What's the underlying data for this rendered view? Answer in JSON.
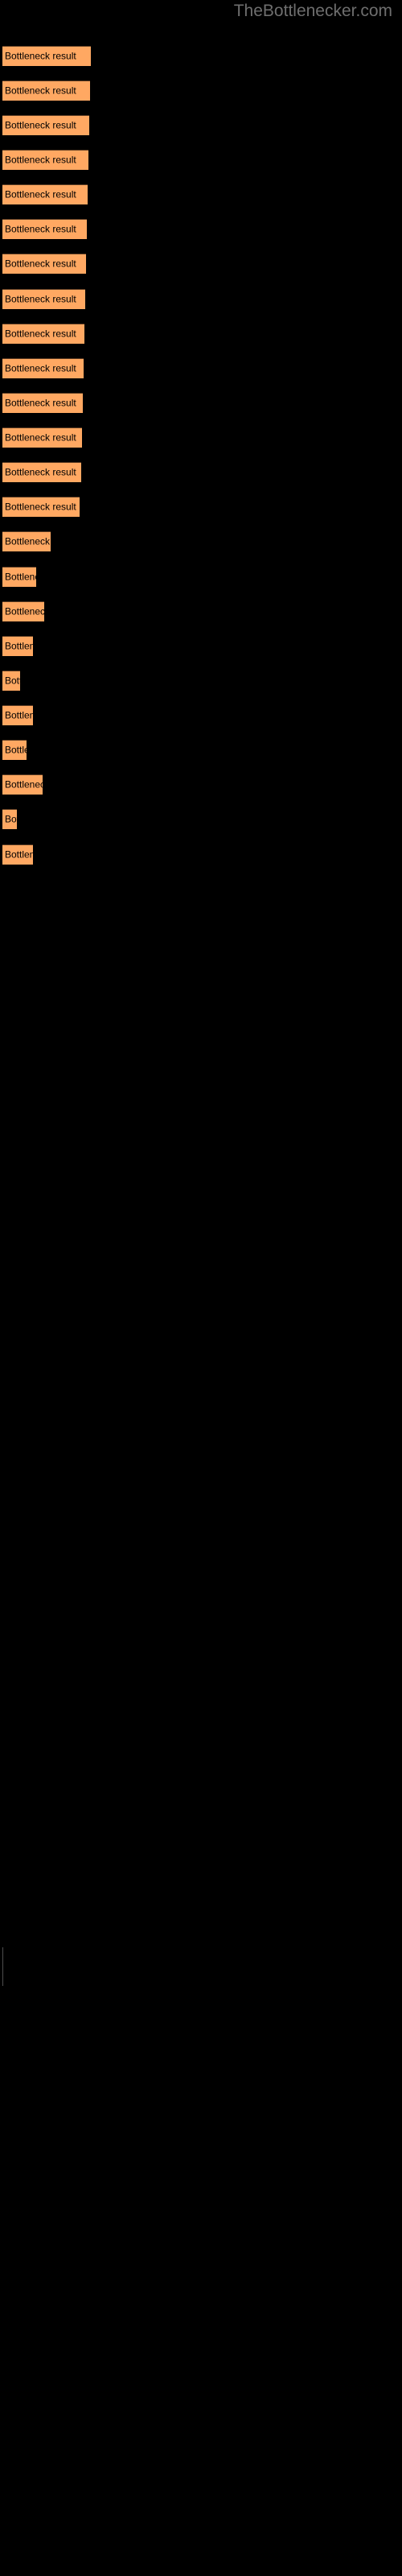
{
  "page": {
    "background_color": "#000000",
    "bar_color": "#ffa862",
    "bar_border_color": "#5a3b22",
    "label_color": "#000000",
    "title_color": "#6e6e6e",
    "axis_color": "#4e4e4e"
  },
  "header": {
    "site_title": "TheBottlenecker.com"
  },
  "axis": {
    "tick_label": "",
    "tick_top": 2419,
    "tick_height": 48
  },
  "chart_data": {
    "type": "bar",
    "orientation": "horizontal",
    "title": "TheBottlenecker.com",
    "xlabel": "",
    "ylabel": "",
    "grid": false,
    "legend": null,
    "bar_color": "#ffa862",
    "categories": [
      "Bottleneck result",
      "Bottleneck result",
      "Bottleneck result",
      "Bottleneck result",
      "Bottleneck result",
      "Bottleneck result",
      "Bottleneck result",
      "Bottleneck result",
      "Bottleneck result",
      "Bottleneck result",
      "Bottleneck result",
      "Bottleneck result",
      "Bottleneck result",
      "Bottleneck result",
      "Bottleneck result",
      "Bottleneck result",
      "Bottleneck result",
      "Bottleneck result",
      "Bottleneck result",
      "Bottleneck result",
      "Bottleneck result",
      "Bottleneck result",
      "Bottleneck result",
      "Bottleneck result"
    ],
    "values": [
      110,
      109,
      108,
      107,
      106,
      105,
      104,
      103,
      102,
      101,
      100,
      99,
      98,
      96,
      80,
      62,
      70,
      55,
      33,
      55,
      43,
      72,
      28,
      56
    ],
    "xlim": [
      0,
      500
    ],
    "bars": [
      {
        "label": "Bottleneck result",
        "width": 110,
        "top": 57
      },
      {
        "label": "Bottleneck result",
        "width": 109,
        "top": 100
      },
      {
        "label": "Bottleneck result",
        "width": 108,
        "top": 143
      },
      {
        "label": "Bottleneck result",
        "width": 107,
        "top": 186
      },
      {
        "label": "Bottleneck result",
        "width": 106,
        "top": 229
      },
      {
        "label": "Bottleneck result",
        "width": 105,
        "top": 272
      },
      {
        "label": "Bottleneck result",
        "width": 104,
        "top": 315
      },
      {
        "label": "Bottleneck result",
        "width": 103,
        "top": 359
      },
      {
        "label": "Bottleneck result",
        "width": 102,
        "top": 402
      },
      {
        "label": "Bottleneck result",
        "width": 101,
        "top": 445
      },
      {
        "label": "Bottleneck result",
        "width": 100,
        "top": 488
      },
      {
        "label": "Bottleneck result",
        "width": 99,
        "top": 531
      },
      {
        "label": "Bottleneck result",
        "width": 98,
        "top": 574
      },
      {
        "label": "Bottleneck result",
        "width": 96,
        "top": 617
      },
      {
        "label": "Bottleneck result",
        "width": 60,
        "top": 660
      },
      {
        "label": "Bottleneck result",
        "width": 42,
        "top": 704
      },
      {
        "label": "Bottleneck result",
        "width": 52,
        "top": 747
      },
      {
        "label": "Bottleneck result",
        "width": 38,
        "top": 790
      },
      {
        "label": "Bottleneck result",
        "width": 22,
        "top": 833
      },
      {
        "label": "Bottleneck result",
        "width": 38,
        "top": 876
      },
      {
        "label": "Bottleneck result",
        "width": 30,
        "top": 919
      },
      {
        "label": "Bottleneck result",
        "width": 50,
        "top": 962
      },
      {
        "label": "Bottleneck result",
        "width": 18,
        "top": 1005
      },
      {
        "label": "Bottleneck result",
        "width": 38,
        "top": 1049
      }
    ]
  }
}
